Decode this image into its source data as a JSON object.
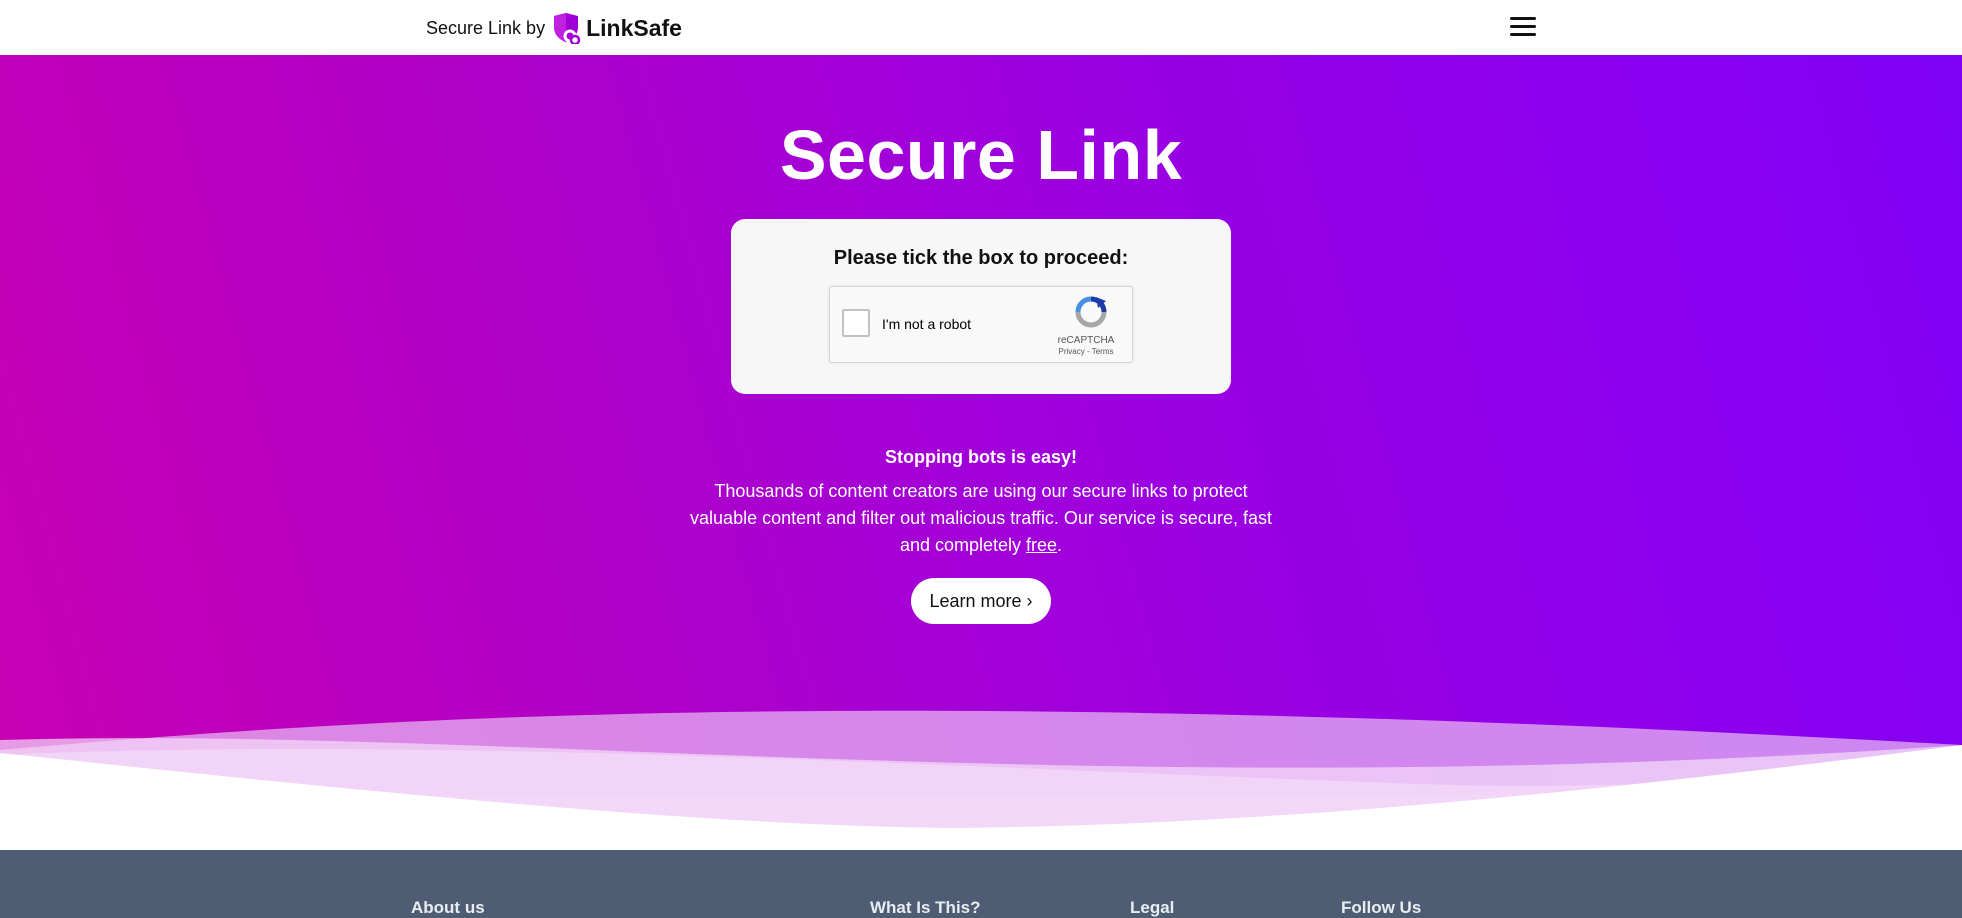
{
  "header": {
    "prefix": "Secure Link by",
    "brand": "LinkSafe",
    "menu_icon": "hamburger-menu-icon"
  },
  "hero": {
    "title": "Secure Link",
    "card_title": "Please tick the box to proceed:",
    "captcha": {
      "label": "I'm not a robot",
      "brand": "reCAPTCHA",
      "privacy": "Privacy",
      "separator": " - ",
      "terms": "Terms",
      "checked": false
    },
    "subtitle": "Stopping bots is easy!",
    "description_pre": "Thousands of content creators are using our secure links to protect valuable content and filter out malicious traffic. Our service is secure, fast and completely ",
    "description_link": "free",
    "description_post": ".",
    "learn_more": "Learn more ›"
  },
  "footer": {
    "columns": [
      "About us",
      "What Is This?",
      "Legal",
      "Follow Us"
    ]
  },
  "colors": {
    "gradient_start": "#c800b4",
    "gradient_end": "#8000f8",
    "footer_bg": "#4e5d73",
    "card_bg": "#f7f7f7"
  }
}
